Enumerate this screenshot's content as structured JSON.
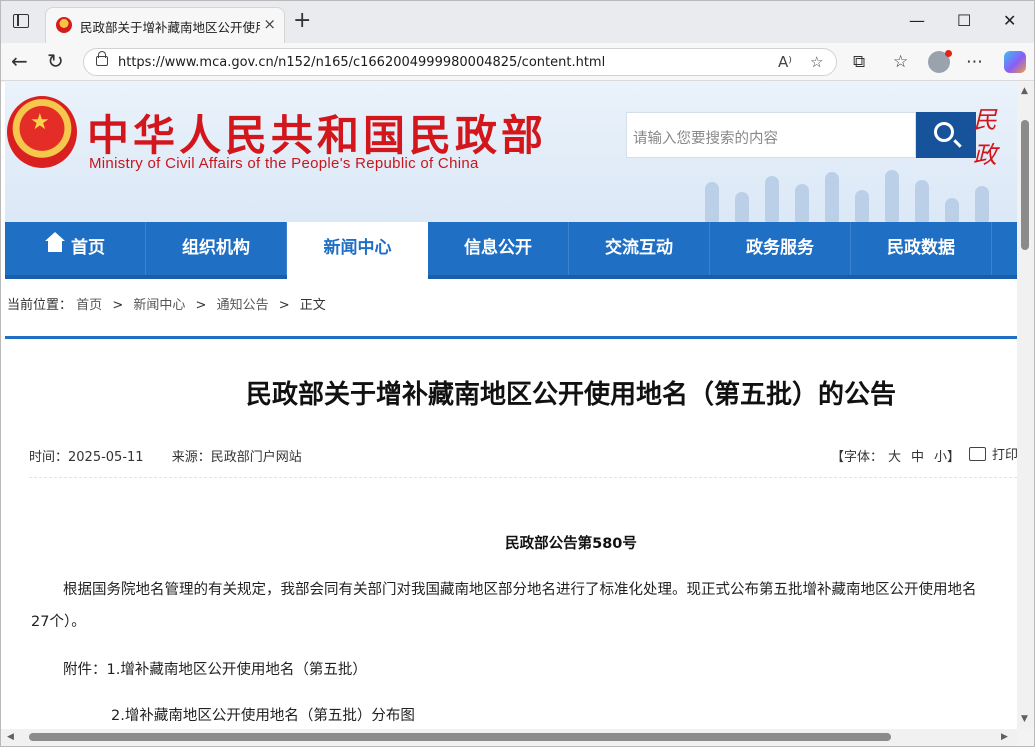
{
  "browser": {
    "tab_title": "民政部关于增补藏南地区公开使用地名",
    "tab_close": "×",
    "new_tab": "+",
    "url": "https://www.mca.gov.cn/n152/n165/c1662004999980004825/content.html",
    "controls": {
      "minimize": "—",
      "maximize": "☐",
      "close": "✕"
    }
  },
  "site": {
    "title": "中华人民共和国民政部",
    "subtitle": "Ministry of Civil Affairs of the People's Republic of China",
    "search_placeholder": "请输入您要搜索的内容",
    "calligraphy": "民政"
  },
  "menu": {
    "items": [
      {
        "label": "首页"
      },
      {
        "label": "组织机构"
      },
      {
        "label": "新闻中心"
      },
      {
        "label": "信息公开"
      },
      {
        "label": "交流互动"
      },
      {
        "label": "政务服务"
      },
      {
        "label": "民政数据"
      }
    ],
    "active_index": 2
  },
  "breadcrumb": {
    "prefix": "当前位置：",
    "items": [
      "首页",
      "新闻中心",
      "通知公告",
      "正文"
    ],
    "separator": ">"
  },
  "article": {
    "title": "民政部关于增补藏南地区公开使用地名（第五批）的公告",
    "date": "时间：2025-05-11",
    "source": "来源：民政部门户网站",
    "font_label": "【字体：",
    "font_large": "大",
    "font_medium": "中",
    "font_small": "小】",
    "print_label": "打印",
    "notice_no": "民政部公告第580号",
    "para1_line1": "根据国务院地名管理的有关规定，我部会同有关部门对我国藏南地区部分地名进行了标准化处理。现正式公布第五批增补藏南地区公开使用地名",
    "para1_line2": "27个）。",
    "attachment1": "附件：1.增补藏南地区公开使用地名（第五批）",
    "attachment2": "2.增补藏南地区公开使用地名（第五批）分布图"
  }
}
